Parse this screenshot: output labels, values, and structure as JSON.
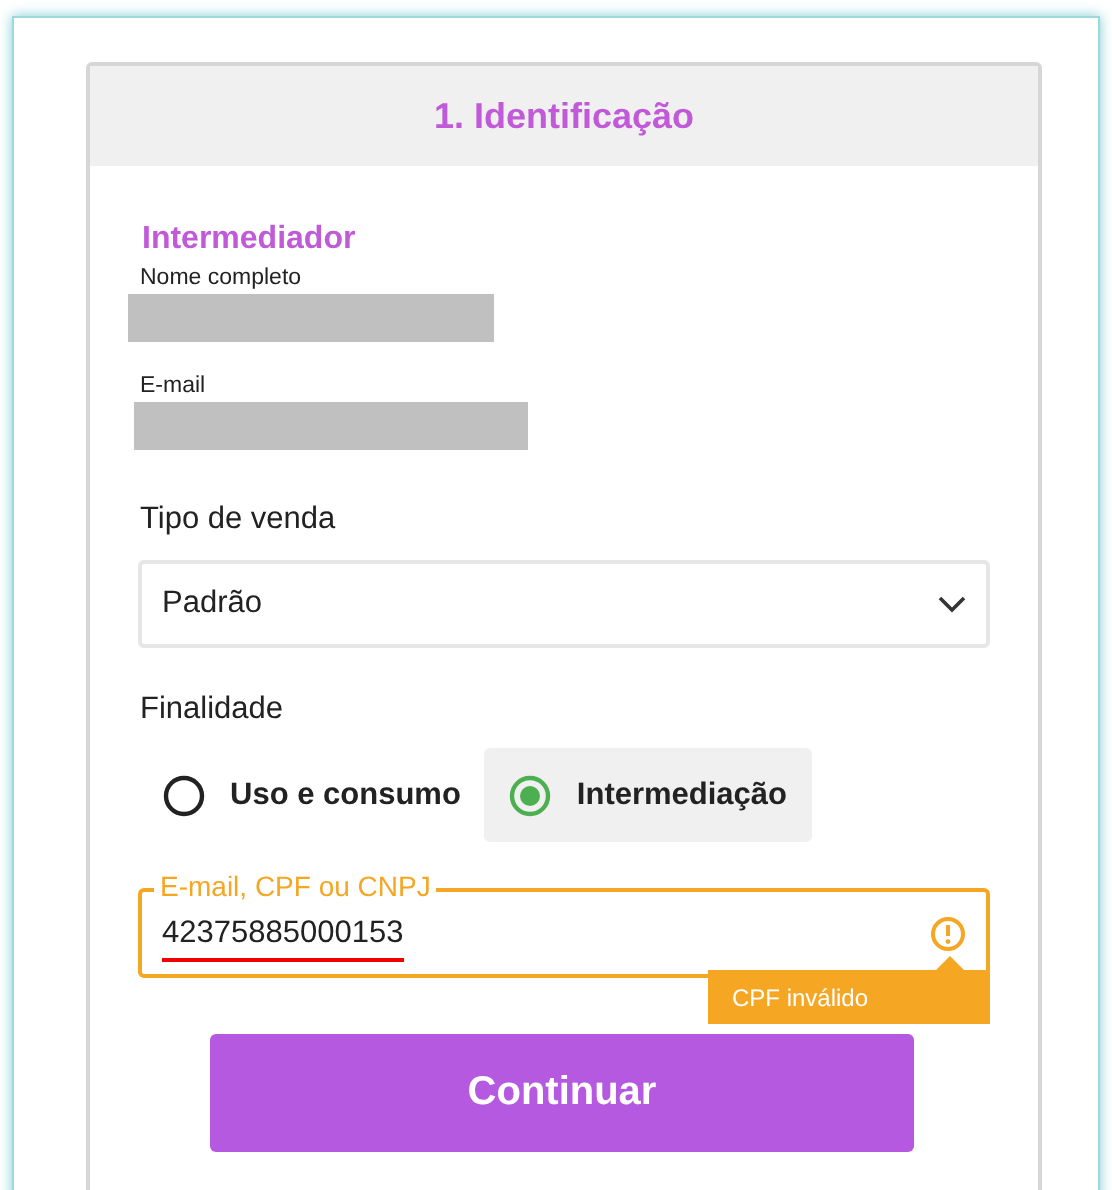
{
  "card": {
    "title": "1. Identificação"
  },
  "intermediary": {
    "heading": "Intermediador",
    "fields": [
      {
        "label": "Nome completo"
      },
      {
        "label": "E-mail"
      }
    ]
  },
  "sale_type": {
    "label": "Tipo de venda",
    "value": "Padrão"
  },
  "purpose": {
    "label": "Finalidade",
    "options": [
      {
        "label": "Uso e consumo",
        "selected": false
      },
      {
        "label": "Intermediação",
        "selected": true
      }
    ]
  },
  "id_field": {
    "label": "E-mail, CPF ou CNPJ",
    "value": "42375885000153",
    "invalid": true,
    "error": "CPF inválido"
  },
  "submit": {
    "label": "Continuar"
  }
}
